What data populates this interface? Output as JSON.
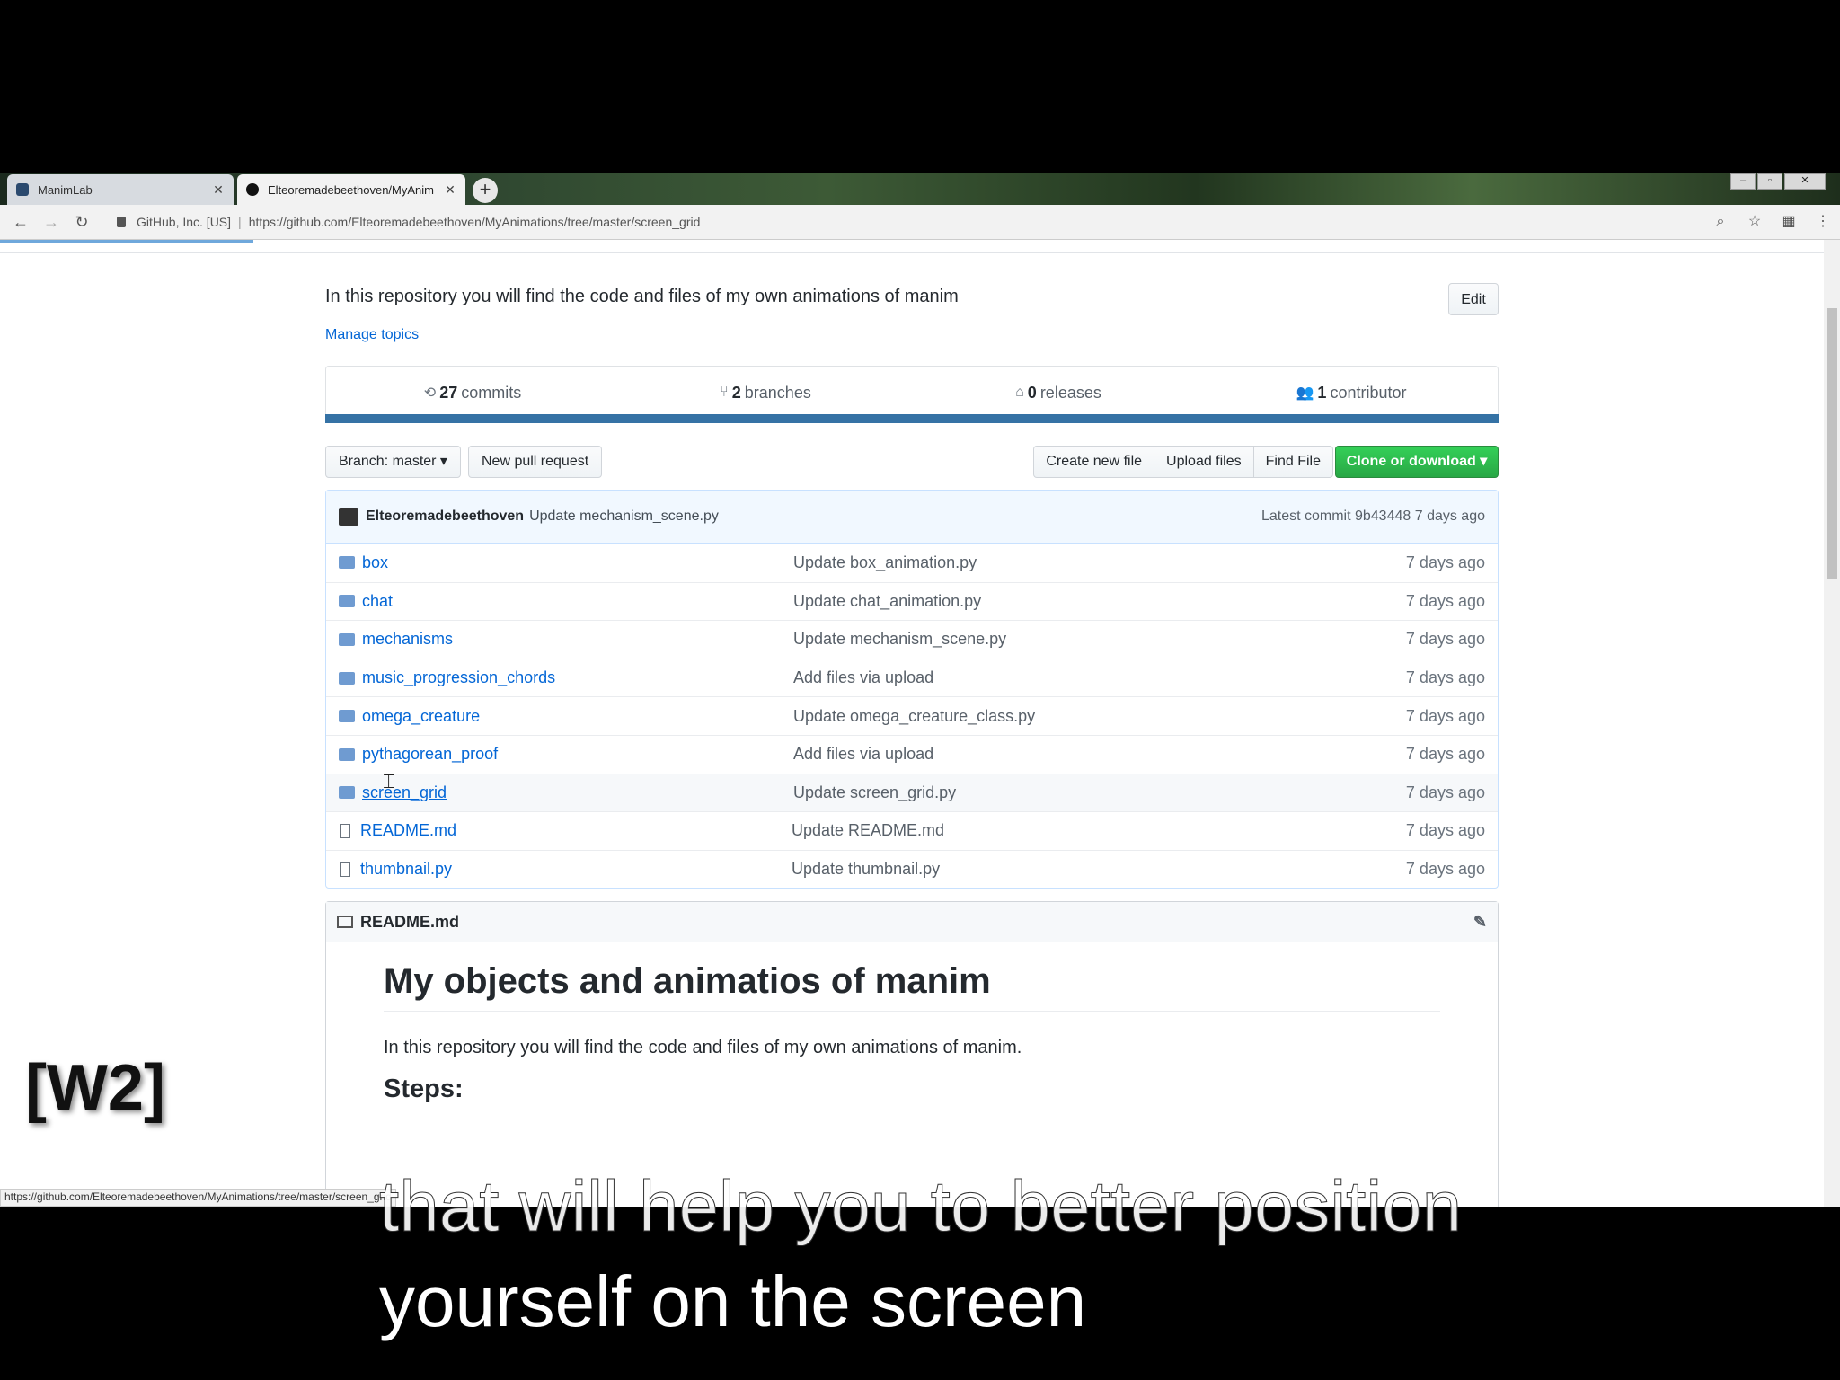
{
  "browser": {
    "tabs": [
      {
        "title": "ManimLab"
      },
      {
        "title": "Elteoremadebeethoven/MyAnim"
      }
    ],
    "new_tab": "+",
    "window_controls": {
      "minimize": "–",
      "maximize": "▫",
      "close": "✕"
    },
    "address": {
      "org": "GitHub, Inc. [US]",
      "url": "https://github.com/Elteoremadebeethoven/MyAnimations/tree/master/screen_grid"
    },
    "status_url": "https://github.com/Elteoremadebeethoven/MyAnimations/tree/master/screen_grid"
  },
  "repo": {
    "description": "In this repository you will find the code and files of my own animations of manim",
    "edit_label": "Edit",
    "manage_topics": "Manage topics",
    "stats": {
      "commits_count": "27",
      "commits_label": "commits",
      "branches_count": "2",
      "branches_label": "branches",
      "releases_count": "0",
      "releases_label": "releases",
      "contributors_count": "1",
      "contributors_label": "contributor"
    },
    "language_color": "#3572a5",
    "branch_label": "Branch: master ▾",
    "new_pr_label": "New pull request",
    "create_file_label": "Create new file",
    "upload_label": "Upload files",
    "find_file_label": "Find File",
    "clone_label": "Clone or download ▾",
    "latest_commit": {
      "author": "Elteoremadebeethoven",
      "message": "Update mechanism_scene.py",
      "info": "Latest commit 9b43448 7 days ago"
    },
    "files": [
      {
        "name": "box",
        "type": "dir",
        "message": "Update box_animation.py",
        "age": "7 days ago"
      },
      {
        "name": "chat",
        "type": "dir",
        "message": "Update chat_animation.py",
        "age": "7 days ago"
      },
      {
        "name": "mechanisms",
        "type": "dir",
        "message": "Update mechanism_scene.py",
        "age": "7 days ago"
      },
      {
        "name": "music_progression_chords",
        "type": "dir",
        "message": "Add files via upload",
        "age": "7 days ago"
      },
      {
        "name": "omega_creature",
        "type": "dir",
        "message": "Update omega_creature_class.py",
        "age": "7 days ago"
      },
      {
        "name": "pythagorean_proof",
        "type": "dir",
        "message": "Add files via upload",
        "age": "7 days ago"
      },
      {
        "name": "screen_grid",
        "type": "dir",
        "message": "Update screen_grid.py",
        "age": "7 days ago"
      },
      {
        "name": "README.md",
        "type": "file",
        "message": "Update README.md",
        "age": "7 days ago"
      },
      {
        "name": "thumbnail.py",
        "type": "file",
        "message": "Update thumbnail.py",
        "age": "7 days ago"
      }
    ],
    "readme": {
      "filename": "README.md",
      "title": "My objects and animatios of manim",
      "paragraph": "In this repository you will find the code and files of my own animations of manim.",
      "steps_heading": "Steps:"
    }
  },
  "overlay": {
    "label": "[W2]",
    "subtitle_line1": "that will help you to better position",
    "subtitle_line2": "yourself on the screen"
  }
}
